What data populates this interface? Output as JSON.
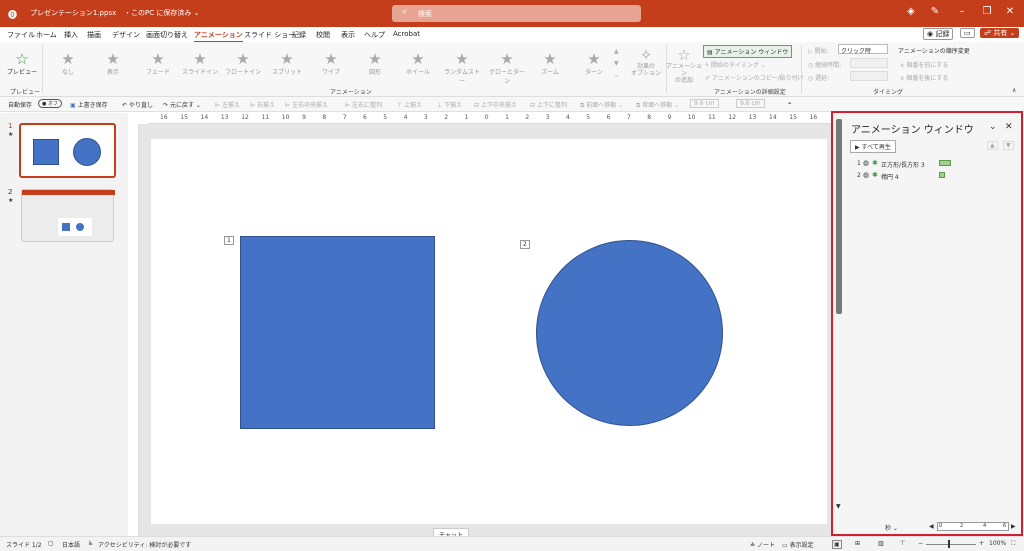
{
  "titlebar": {
    "filename": "プレゼンテーション1.ppsx",
    "save_status": "このPC に保存済み",
    "search_placeholder": "検索"
  },
  "tabs": [
    "ファイル",
    "ホーム",
    "挿入",
    "描画",
    "デザイン",
    "画面切り替え",
    "アニメーション",
    "スライド ショー",
    "記録",
    "校閲",
    "表示",
    "ヘルプ",
    "Acrobat"
  ],
  "top_right": {
    "record": "記録",
    "share": "共有"
  },
  "ribbon": {
    "preview": "プレビュー",
    "preview_group": "プレビュー",
    "effects": [
      "なし",
      "表示",
      "フェード",
      "スライドイン",
      "フロートイン",
      "スプリット",
      "ワイプ",
      "図形",
      "ホイール",
      "ランダムストー",
      "グローとターン",
      "ズーム",
      "ターン"
    ],
    "effect_options": "効果の\nオプション",
    "animation_group": "アニメーション",
    "add_animation": "アニメーション\nの追加",
    "animation_pane": "アニメーション ウィンドウ",
    "trigger": "開始のタイミング",
    "painter": "アニメーションのコピー/貼り付け",
    "advanced_group": "アニメーションの詳細設定",
    "start_label": "開始:",
    "start_value": "クリック時",
    "duration_label": "継続時間:",
    "delay_label": "遅延:",
    "timing_group": "タイミング",
    "reorder_title": "アニメーションの順序変更",
    "move_earlier": "順番を前にする",
    "move_later": "順番を後にする"
  },
  "qat": {
    "autosave": "自動保存",
    "autosave_state": "オフ",
    "save": "上書き保存",
    "undo": "やり直し",
    "redo": "元に戻す",
    "items": [
      "左揃え",
      "右揃え",
      "左右中央揃え",
      "左右に整列",
      "上揃え",
      "下揃え",
      "上下中央揃え",
      "上下に整列",
      "前面へ移動",
      "背面へ移動"
    ],
    "w": "9.6 cm",
    "h": "9.6 cm"
  },
  "slides": [
    {
      "num": "1"
    },
    {
      "num": "2"
    }
  ],
  "ruler": {
    "h": [
      "16",
      "15",
      "14",
      "13",
      "12",
      "11",
      "10",
      "9",
      "8",
      "7",
      "6",
      "5",
      "4",
      "3",
      "2",
      "1",
      "0",
      "1",
      "2",
      "3",
      "4",
      "5",
      "6",
      "7",
      "8",
      "9",
      "10",
      "11",
      "12",
      "13",
      "14",
      "15",
      "16"
    ]
  },
  "slide": {
    "tag1": "1",
    "tag2": "2",
    "color": "#4472c4",
    "chat": "チャット"
  },
  "pane": {
    "title": "アニメーション ウィンドウ",
    "play_all": "すべて再生",
    "items": [
      {
        "num": "1",
        "name": "正方形/長方形 3"
      },
      {
        "num": "2",
        "name": "楕円 4"
      }
    ],
    "seconds": "秒",
    "timeline": [
      "0",
      "2",
      "4",
      "6"
    ]
  },
  "status": {
    "slide": "スライド 1/2",
    "lang": "日本語",
    "access": "アクセシビリティ: 検討が必要です",
    "notes": "ノート",
    "display": "表示設定",
    "zoom": "100%"
  }
}
